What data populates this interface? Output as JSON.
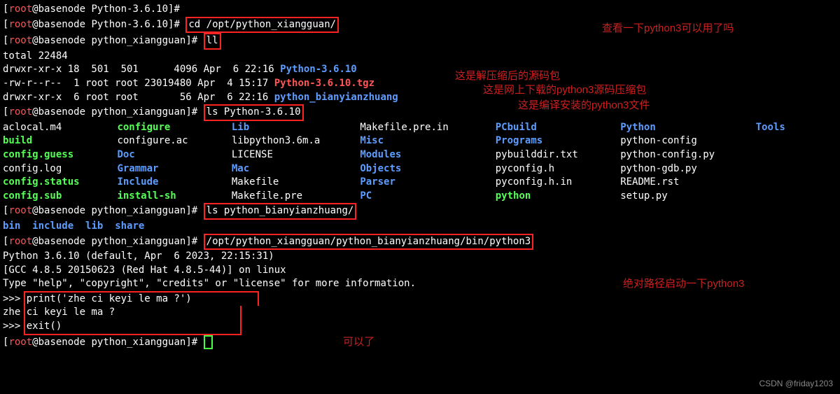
{
  "prompt": {
    "user": "root",
    "host": "basenode",
    "path1": "Python-3.6.10",
    "path2": "python_xiangguan",
    "symbol": "#"
  },
  "cmds": {
    "cd": "cd /opt/python_xiangguan/",
    "ll": "ll",
    "ls1": "ls Python-3.6.10",
    "ls2": "ls python_bianyianzhuang/",
    "run": "/opt/python_xiangguan/python_bianyianzhuang/bin/python3",
    "print": "print('zhe ci keyi le ma ?')",
    "print_out": "zhe ci keyi le ma ?",
    "exit": "exit()"
  },
  "ll_out": {
    "total": "total 22484",
    "r1": {
      "perm": "drwxr-xr-x 18  501  501      4096 Apr  6 22:16 ",
      "name": "Python-3.6.10"
    },
    "r2": {
      "perm": "-rw-r--r--  1 root root 23019480 Apr  4 15:17 ",
      "name": "Python-3.6.10.tgz"
    },
    "r3": {
      "perm": "drwxr-xr-x  6 root root       56 Apr  6 22:16 ",
      "name": "python_bianyianzhuang"
    }
  },
  "cols": {
    "c1": [
      "aclocal.m4",
      "build",
      "config.guess",
      "config.log",
      "config.status",
      "config.sub"
    ],
    "c1c": [
      "txt",
      "exec",
      "exec",
      "txt",
      "exec",
      "exec"
    ],
    "c2": [
      "configure",
      "configure.ac",
      "Doc",
      "Grammar",
      "Include",
      "install-sh"
    ],
    "c2c": [
      "exec",
      "txt",
      "dir",
      "dir",
      "dir",
      "exec"
    ],
    "c3": [
      "Lib",
      "libpython3.6m.a",
      "LICENSE",
      "Mac",
      "Makefile",
      "Makefile.pre"
    ],
    "c3c": [
      "dir",
      "txt",
      "txt",
      "dir",
      "txt",
      "txt"
    ],
    "c4": [
      "Makefile.pre.in",
      "Misc",
      "Modules",
      "Objects",
      "Parser",
      "PC"
    ],
    "c4c": [
      "txt",
      "dir",
      "dir",
      "dir",
      "dir",
      "dir"
    ],
    "c5": [
      "PCbuild",
      "Programs",
      "pybuilddir.txt",
      "pyconfig.h",
      "pyconfig.h.in",
      "python"
    ],
    "c5c": [
      "dir",
      "dir",
      "txt",
      "txt",
      "txt",
      "exec"
    ],
    "c6": [
      "Python",
      "python-config",
      "python-config.py",
      "python-gdb.py",
      "README.rst",
      "setup.py"
    ],
    "c6c": [
      "dir",
      "txt",
      "txt",
      "txt",
      "txt",
      "txt"
    ],
    "c7": [
      "Tools"
    ],
    "c7c": [
      "dir"
    ]
  },
  "ls2_out": [
    "bin",
    "include",
    "lib",
    "share"
  ],
  "py": {
    "ver": "Python 3.6.10 (default, Apr  6 2023, 22:15:31)",
    "gcc": "[GCC 4.8.5 20150623 (Red Hat 4.8.5-44)] on linux",
    "help": "Type \"help\", \"copyright\", \"credits\" or \"license\" for more information.",
    "ps": ">>> "
  },
  "ann": {
    "a1": "查看一下python3可以用了吗",
    "a2": "这是解压缩后的源码包",
    "a3": "这是网上下载的python3源码压缩包",
    "a4": "这是编译安装的python3文件",
    "a5": "绝对路径启动一下python3",
    "a6": "可以了"
  },
  "watermark": "CSDN @friday1203"
}
